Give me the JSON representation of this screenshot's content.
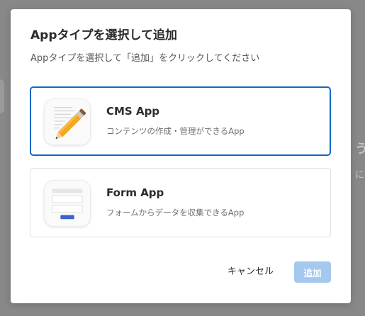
{
  "dialog": {
    "title": "Appタイプを選択して追加",
    "description": "Appタイプを選択して「追加」をクリックしてください",
    "options": [
      {
        "name": "CMS App",
        "description": "コンテンツの作成・管理ができるApp",
        "icon": "pencil-document-icon",
        "selected": true
      },
      {
        "name": "Form App",
        "description": "フォームからデータを収集できるApp",
        "icon": "form-icon",
        "selected": false
      }
    ],
    "cancel_label": "キャンセル",
    "add_label": "追加",
    "add_enabled": false
  },
  "background": {
    "fragment_1": "う",
    "fragment_2": "に"
  },
  "colors": {
    "accent": "#0f68c8",
    "disabled_button": "#a5c8ee",
    "overlay": "#888888"
  }
}
